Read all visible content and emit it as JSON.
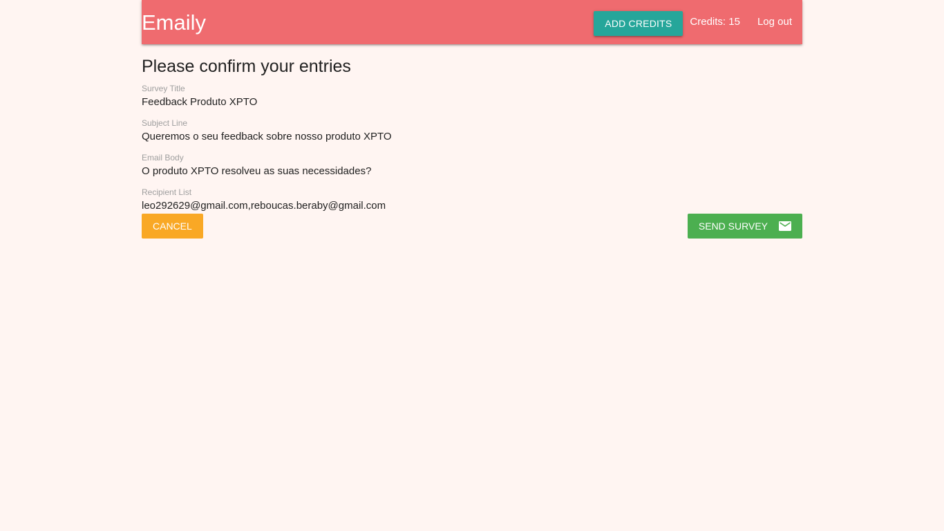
{
  "app": {
    "brand": "Emaily"
  },
  "header": {
    "add_credits_label": "Add Credits",
    "credits_text": "Credits: 15",
    "logout_label": "Log out"
  },
  "main": {
    "title": "Please confirm your entries",
    "fields": [
      {
        "label": "Survey Title",
        "value": "Feedback Produto XPTO"
      },
      {
        "label": "Subject Line",
        "value": "Queremos o seu feedback sobre nosso produto XPTO"
      },
      {
        "label": "Email Body",
        "value": "O produto XPTO resolveu as suas necessidades?"
      },
      {
        "label": "Recipient List",
        "value": "leo292629@gmail.com,reboucas.beraby@gmail.com"
      }
    ],
    "cancel_label": "Cancel",
    "send_label": "Send Survey",
    "send_icon": "email-icon"
  },
  "colors": {
    "navbar": "#ef6b6f",
    "background": "#fff5f2",
    "add_credits": "#26a69a",
    "cancel": "#f9a825",
    "send": "#4caf50"
  }
}
